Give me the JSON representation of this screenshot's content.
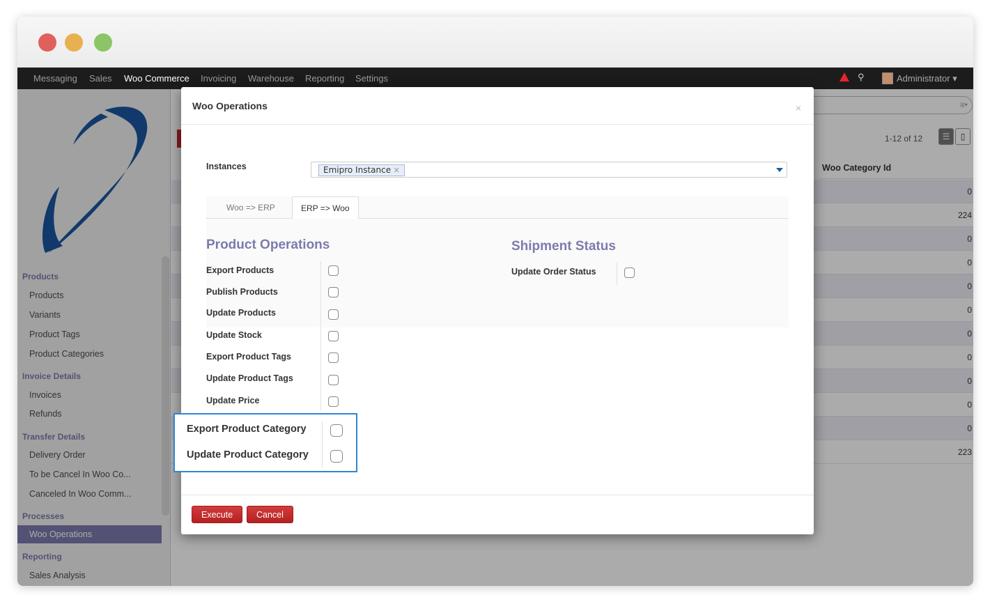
{
  "topnav": {
    "items": [
      "Messaging",
      "Sales",
      "Woo Commerce",
      "Invoicing",
      "Warehouse",
      "Reporting",
      "Settings"
    ],
    "active": "Woo Commerce",
    "user": "Administrator ▾"
  },
  "sidebar": {
    "sections": [
      {
        "title": "Products",
        "items": [
          "Products",
          "Variants",
          "Product Tags",
          "Product Categories"
        ]
      },
      {
        "title": "Invoice Details",
        "items": [
          "Invoices",
          "Refunds"
        ]
      },
      {
        "title": "Transfer Details",
        "items": [
          "Delivery Order",
          "To be Cancel In Woo Co...",
          "Canceled In Woo Comm..."
        ]
      },
      {
        "title": "Processes",
        "items": [
          "Woo Operations"
        ]
      },
      {
        "title": "Reporting",
        "items": [
          "Sales Analysis"
        ]
      }
    ],
    "active_item": "Woo Operations"
  },
  "list": {
    "pager": "1-12 of 12",
    "column_header": "Woo Category Id",
    "values": [
      "0",
      "224",
      "0",
      "0",
      "0",
      "0",
      "0",
      "0",
      "0",
      "0",
      "0",
      "223"
    ]
  },
  "modal": {
    "title": "Woo Operations",
    "close": "×",
    "instances_label": "Instances",
    "instance_tag": "Emipro Instance",
    "tag_remove": "×",
    "tabs": [
      "Woo => ERP",
      "ERP => Woo"
    ],
    "active_tab": "ERP => Woo",
    "product_operations": {
      "title": "Product Operations",
      "items": [
        "Export Products",
        "Publish Products",
        "Update Products",
        "Update Stock",
        "Export Product Tags",
        "Update Product Tags",
        "Update Price"
      ]
    },
    "shipment_status": {
      "title": "Shipment Status",
      "items": [
        "Update Order Status"
      ]
    },
    "highlighted_items": [
      "Export Product Category",
      "Update Product Category"
    ],
    "execute_label": "Execute",
    "cancel_label": "Cancel"
  }
}
